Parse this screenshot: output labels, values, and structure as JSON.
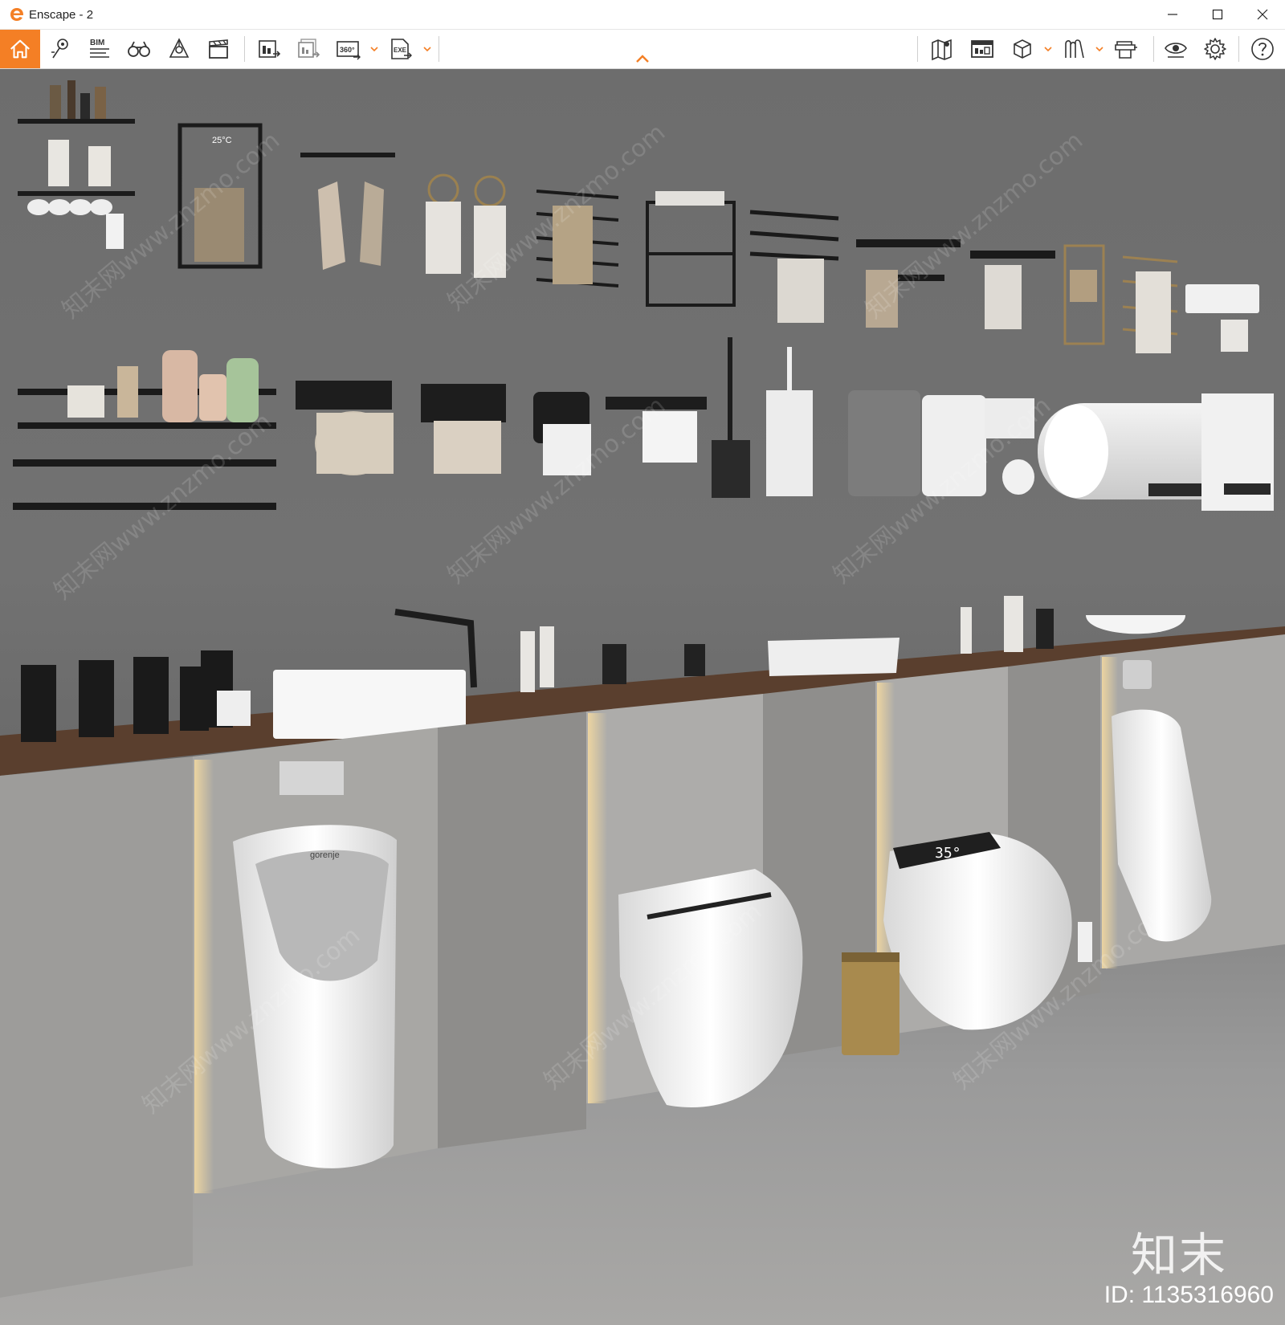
{
  "window": {
    "title": "Enscape - 2",
    "controls": {
      "minimize": "—",
      "maximize": "☐",
      "close": "✕"
    },
    "accent_color": "#f47f25"
  },
  "toolbar": {
    "left_icons": [
      "home-icon",
      "pin-icon",
      "bim-icon",
      "binoculars-icon",
      "light-bulb-icon",
      "clapperboard-icon",
      "screenshot-icon",
      "batch-render-icon",
      "panorama-360-icon",
      "export-exe-icon"
    ],
    "right_icons": [
      "map-icon",
      "info-panel-icon",
      "cube-view-icon",
      "asset-library-icon",
      "material-editor-icon",
      "visual-settings-icon",
      "gear-icon",
      "help-icon"
    ],
    "bim_label": "BIM",
    "pano_label": "360°",
    "exe_label": "EXE"
  },
  "viewport": {
    "scene": "3D render of bathroom fixtures and accessories",
    "watermark_text": "知末网www.znzmo.com",
    "logo_text": "知末",
    "id_text": "ID: 1135316960",
    "thermostat_label": "25°C",
    "smart_toilet_display": "35°",
    "urinal_brand": "gorenje"
  }
}
